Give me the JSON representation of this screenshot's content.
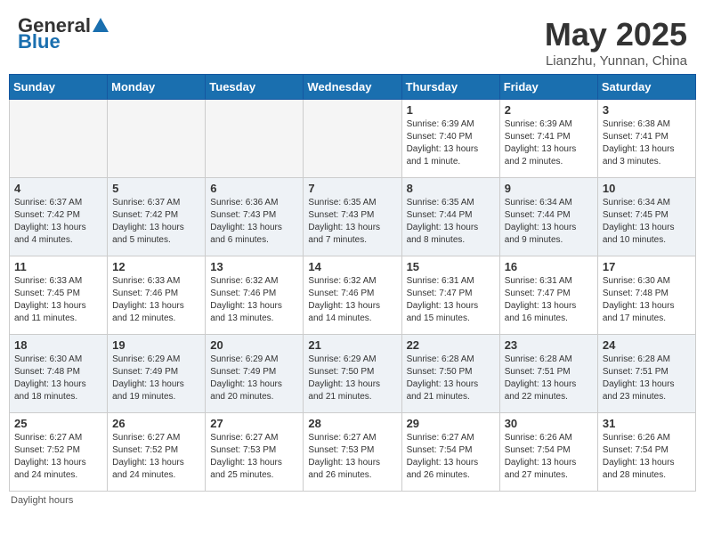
{
  "header": {
    "logo_general": "General",
    "logo_blue": "Blue",
    "title": "May 2025",
    "location": "Lianzhu, Yunnan, China"
  },
  "days_of_week": [
    "Sunday",
    "Monday",
    "Tuesday",
    "Wednesday",
    "Thursday",
    "Friday",
    "Saturday"
  ],
  "weeks": [
    [
      {
        "day": "",
        "info": ""
      },
      {
        "day": "",
        "info": ""
      },
      {
        "day": "",
        "info": ""
      },
      {
        "day": "",
        "info": ""
      },
      {
        "day": "1",
        "info": "Sunrise: 6:39 AM\nSunset: 7:40 PM\nDaylight: 13 hours and 1 minute."
      },
      {
        "day": "2",
        "info": "Sunrise: 6:39 AM\nSunset: 7:41 PM\nDaylight: 13 hours and 2 minutes."
      },
      {
        "day": "3",
        "info": "Sunrise: 6:38 AM\nSunset: 7:41 PM\nDaylight: 13 hours and 3 minutes."
      }
    ],
    [
      {
        "day": "4",
        "info": "Sunrise: 6:37 AM\nSunset: 7:42 PM\nDaylight: 13 hours and 4 minutes."
      },
      {
        "day": "5",
        "info": "Sunrise: 6:37 AM\nSunset: 7:42 PM\nDaylight: 13 hours and 5 minutes."
      },
      {
        "day": "6",
        "info": "Sunrise: 6:36 AM\nSunset: 7:43 PM\nDaylight: 13 hours and 6 minutes."
      },
      {
        "day": "7",
        "info": "Sunrise: 6:35 AM\nSunset: 7:43 PM\nDaylight: 13 hours and 7 minutes."
      },
      {
        "day": "8",
        "info": "Sunrise: 6:35 AM\nSunset: 7:44 PM\nDaylight: 13 hours and 8 minutes."
      },
      {
        "day": "9",
        "info": "Sunrise: 6:34 AM\nSunset: 7:44 PM\nDaylight: 13 hours and 9 minutes."
      },
      {
        "day": "10",
        "info": "Sunrise: 6:34 AM\nSunset: 7:45 PM\nDaylight: 13 hours and 10 minutes."
      }
    ],
    [
      {
        "day": "11",
        "info": "Sunrise: 6:33 AM\nSunset: 7:45 PM\nDaylight: 13 hours and 11 minutes."
      },
      {
        "day": "12",
        "info": "Sunrise: 6:33 AM\nSunset: 7:46 PM\nDaylight: 13 hours and 12 minutes."
      },
      {
        "day": "13",
        "info": "Sunrise: 6:32 AM\nSunset: 7:46 PM\nDaylight: 13 hours and 13 minutes."
      },
      {
        "day": "14",
        "info": "Sunrise: 6:32 AM\nSunset: 7:46 PM\nDaylight: 13 hours and 14 minutes."
      },
      {
        "day": "15",
        "info": "Sunrise: 6:31 AM\nSunset: 7:47 PM\nDaylight: 13 hours and 15 minutes."
      },
      {
        "day": "16",
        "info": "Sunrise: 6:31 AM\nSunset: 7:47 PM\nDaylight: 13 hours and 16 minutes."
      },
      {
        "day": "17",
        "info": "Sunrise: 6:30 AM\nSunset: 7:48 PM\nDaylight: 13 hours and 17 minutes."
      }
    ],
    [
      {
        "day": "18",
        "info": "Sunrise: 6:30 AM\nSunset: 7:48 PM\nDaylight: 13 hours and 18 minutes."
      },
      {
        "day": "19",
        "info": "Sunrise: 6:29 AM\nSunset: 7:49 PM\nDaylight: 13 hours and 19 minutes."
      },
      {
        "day": "20",
        "info": "Sunrise: 6:29 AM\nSunset: 7:49 PM\nDaylight: 13 hours and 20 minutes."
      },
      {
        "day": "21",
        "info": "Sunrise: 6:29 AM\nSunset: 7:50 PM\nDaylight: 13 hours and 21 minutes."
      },
      {
        "day": "22",
        "info": "Sunrise: 6:28 AM\nSunset: 7:50 PM\nDaylight: 13 hours and 21 minutes."
      },
      {
        "day": "23",
        "info": "Sunrise: 6:28 AM\nSunset: 7:51 PM\nDaylight: 13 hours and 22 minutes."
      },
      {
        "day": "24",
        "info": "Sunrise: 6:28 AM\nSunset: 7:51 PM\nDaylight: 13 hours and 23 minutes."
      }
    ],
    [
      {
        "day": "25",
        "info": "Sunrise: 6:27 AM\nSunset: 7:52 PM\nDaylight: 13 hours and 24 minutes."
      },
      {
        "day": "26",
        "info": "Sunrise: 6:27 AM\nSunset: 7:52 PM\nDaylight: 13 hours and 24 minutes."
      },
      {
        "day": "27",
        "info": "Sunrise: 6:27 AM\nSunset: 7:53 PM\nDaylight: 13 hours and 25 minutes."
      },
      {
        "day": "28",
        "info": "Sunrise: 6:27 AM\nSunset: 7:53 PM\nDaylight: 13 hours and 26 minutes."
      },
      {
        "day": "29",
        "info": "Sunrise: 6:27 AM\nSunset: 7:54 PM\nDaylight: 13 hours and 26 minutes."
      },
      {
        "day": "30",
        "info": "Sunrise: 6:26 AM\nSunset: 7:54 PM\nDaylight: 13 hours and 27 minutes."
      },
      {
        "day": "31",
        "info": "Sunrise: 6:26 AM\nSunset: 7:54 PM\nDaylight: 13 hours and 28 minutes."
      }
    ]
  ],
  "footer": {
    "note": "Daylight hours"
  },
  "colors": {
    "header_bg": "#1a6faf",
    "accent": "#1a6faf"
  }
}
